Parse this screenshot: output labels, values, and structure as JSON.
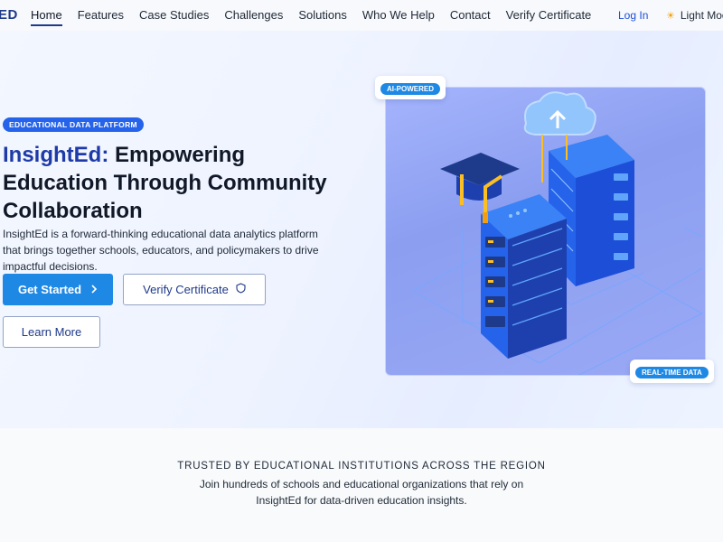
{
  "nav": {
    "logo": "ED",
    "links": [
      {
        "label": "Home",
        "active": true
      },
      {
        "label": "Features"
      },
      {
        "label": "Case Studies"
      },
      {
        "label": "Challenges"
      },
      {
        "label": "Solutions"
      },
      {
        "label": "Who We Help"
      },
      {
        "label": "Contact"
      },
      {
        "label": "Verify Certificate"
      }
    ],
    "login": "Log In",
    "theme": "Light Mode"
  },
  "hero": {
    "badge": "EDUCATIONAL DATA PLATFORM",
    "title_brand": "InsightEd:",
    "title_rest": " Empowering Education Through Community Collaboration",
    "description": "InsightEd is a forward-thinking educational data analytics platform that brings together schools, educators, and policymakers to drive impactful decisions.",
    "buttons": {
      "get_started": "Get Started",
      "verify": "Verify Certificate",
      "learn_more": "Learn More"
    },
    "pills": {
      "ai": "AI-POWERED",
      "realtime": "REAL-TIME DATA"
    }
  },
  "trusted": {
    "title": "TRUSTED BY EDUCATIONAL INSTITUTIONS ACROSS THE REGION",
    "subtitle": "Join hundreds of schools and educational organizations that rely on InsightEd for data-driven education insights."
  },
  "colors": {
    "brand": "#1e3aa8",
    "primary": "#1e88e5",
    "accent": "#2563eb"
  }
}
